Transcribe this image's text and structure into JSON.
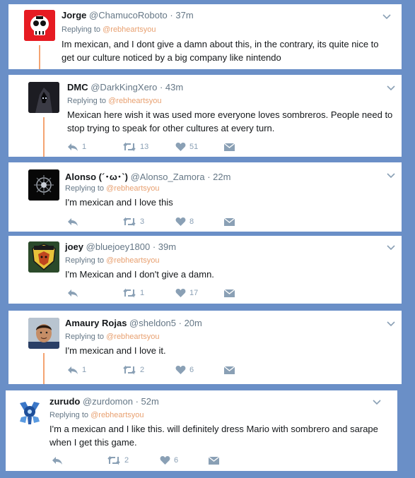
{
  "tweets": [
    {
      "name": "Jorge",
      "handle": "@ChamucoRoboto",
      "time": "· 37m",
      "replying_prefix": "Replying to",
      "replying_handle": "@rebheartsyou",
      "text": "Im mexican, and I dont give a damn about this, in the contrary, its quite nice to get our culture noticed by a big company like nintendo",
      "avatar_icon": "skull-logo-avatar"
    },
    {
      "name": "DMC",
      "handle": "@DarkKingXero",
      "time": "· 43m",
      "replying_prefix": "Replying to",
      "replying_handle": "@rebheartsyou",
      "text": "Mexican here wish it was used more everyone loves sombreros. People need to stop trying to speak for other cultures at every turn.",
      "reply_count": "1",
      "retweet_count": "13",
      "like_count": "51",
      "avatar_icon": "dark-hooded-figure-avatar"
    },
    {
      "name": "Alonso (´･ω･`)",
      "handle": "@Alonso_Zamora",
      "time": "· 22m",
      "replying_prefix": "Replying to",
      "replying_handle": "@rebheartsyou",
      "text": "I'm mexican and I love this",
      "reply_count": "",
      "retweet_count": "3",
      "like_count": "8",
      "avatar_icon": "dark-emblem-avatar"
    },
    {
      "name": "joey",
      "handle": "@bluejoey1800",
      "time": "· 39m",
      "replying_prefix": "Replying to",
      "replying_handle": "@rebheartsyou",
      "text": "I'm Mexican and I don't give a damn.",
      "reply_count": "",
      "retweet_count": "1",
      "like_count": "17",
      "avatar_icon": "fox-hound-emblem-avatar"
    },
    {
      "name": "Amaury Rojas",
      "handle": "@sheldon5",
      "time": "· 20m",
      "replying_prefix": "Replying to",
      "replying_handle": "@rebheartsyou",
      "text": "I'm mexican and I love it.",
      "reply_count": "1",
      "retweet_count": "2",
      "like_count": "6",
      "avatar_icon": "profile-photo-avatar"
    },
    {
      "name": "zurudo",
      "handle": "@zurdomon",
      "time": "· 52m",
      "replying_prefix": "Replying to",
      "replying_handle": "@rebheartsyou",
      "text": "I'm a mexican and I like this. will definitely dress Mario with sombrero and sarape when I get this game.",
      "reply_count": "",
      "retweet_count": "2",
      "like_count": "6",
      "avatar_icon": "blue-robot-avatar"
    }
  ],
  "colors": {
    "background": "#6a8fc7",
    "name": "#14171a",
    "meta": "#657786",
    "reply_link": "#e8a070",
    "thread_line": "#f4a472",
    "action_icon": "#8aa0b5"
  }
}
